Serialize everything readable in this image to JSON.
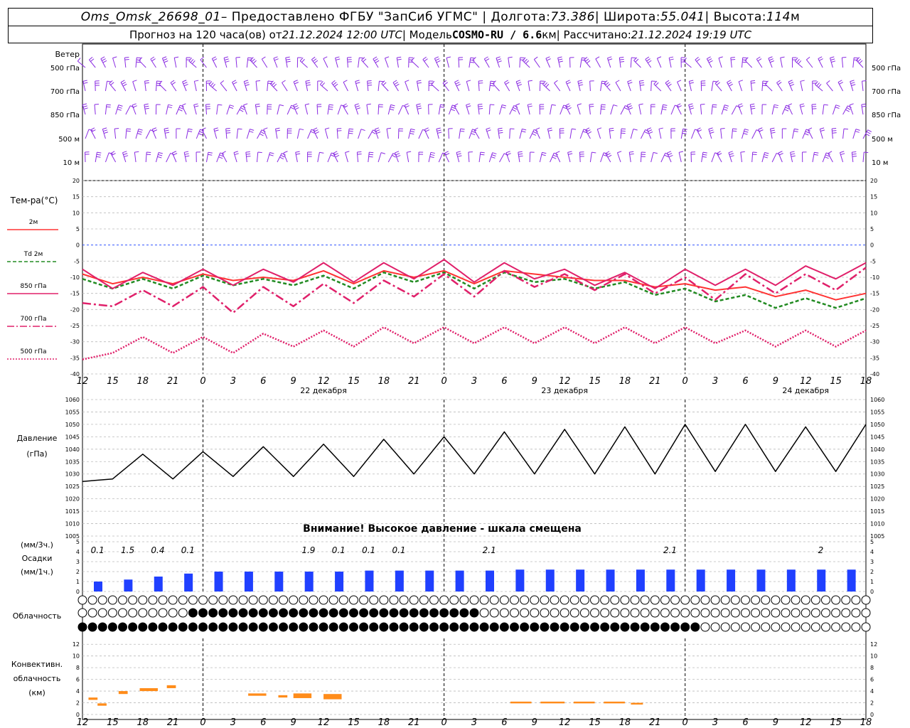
{
  "header": {
    "line1": {
      "station": "Oms_Omsk_26698_01",
      "provider": " – Предоставлено ФГБУ \"ЗапСиб УГМС\" | Долгота: ",
      "lon": "73.386",
      "lat_label": " | Широта: ",
      "lat": "55.041",
      "alt_label": " | Высота: ",
      "alt": "114",
      "alt_unit": "м"
    },
    "line2": {
      "forecast": "Прогноз на 120 часа(ов) от ",
      "run_time": "21.12.2024 12:00 UTC",
      "model_label": " | Модель ",
      "model": "COSMO-RU / 6.6",
      "model_unit": "км",
      "calc_label": " | Рассчитано: ",
      "calc_time": "21.12.2024 19:19 UTC"
    }
  },
  "time_axis": {
    "hour_labels": [
      "12",
      "15",
      "18",
      "21",
      "0",
      "3",
      "6",
      "9",
      "12",
      "15",
      "18",
      "21",
      "0",
      "3",
      "6",
      "9",
      "12",
      "15",
      "18",
      "21",
      "0",
      "3",
      "6",
      "9",
      "12",
      "15",
      "18"
    ],
    "date_labels": [
      "22 декабря",
      "23 декабря",
      "24 декабря"
    ]
  },
  "wind_panel": {
    "title": "Ветер",
    "levels": [
      "500 гПа",
      "700 гПа",
      "850 гПа",
      "500 м",
      "10 м"
    ],
    "colors": {
      "barb": "#8a2be2"
    }
  },
  "temp_panel": {
    "title": "Тем-ра(°С)",
    "legend": [
      {
        "label": "2м",
        "color": "#ff3333",
        "style": "solid"
      },
      {
        "label_sym": "Td",
        "label": "2м",
        "color": "#228b22",
        "style": "dashed"
      },
      {
        "label": "850 гПа",
        "color": "#e0206a",
        "style": "solid"
      },
      {
        "label": "700 гПа",
        "color": "#e0206a",
        "style": "dashdot"
      },
      {
        "label": "500 гПа",
        "color": "#e0206a",
        "style": "dotted"
      }
    ],
    "ticks": [
      "20",
      "15",
      "10",
      "5",
      "0",
      "-5",
      "-10",
      "-15",
      "-20",
      "-25",
      "-30",
      "-35",
      "-40"
    ]
  },
  "pressure_panel": {
    "title1": "Давление",
    "title2": "(гПа)",
    "ticks": [
      "1060",
      "1055",
      "1050",
      "1045",
      "1040",
      "1035",
      "1030",
      "1025",
      "1020",
      "1015",
      "1010",
      "1005"
    ],
    "warning": "Внимание! Высокое давление - шкала смещена"
  },
  "precip_panel": {
    "title1": "(мм/3ч.)",
    "title2": "Осадки",
    "title3": "(мм/1ч.)",
    "ticks": [
      "5",
      "4",
      "3",
      "2",
      "1",
      "0"
    ],
    "totals": [
      {
        "at": 0.5,
        "text": "0.1"
      },
      {
        "at": 1.5,
        "text": "1.5"
      },
      {
        "at": 2.5,
        "text": "0.4"
      },
      {
        "at": 3.5,
        "text": "0.1"
      },
      {
        "at": 7.5,
        "text": "1.9"
      },
      {
        "at": 8.5,
        "text": "0.1"
      },
      {
        "at": 9.5,
        "text": "0.1"
      },
      {
        "at": 10.5,
        "text": "0.1"
      },
      {
        "at": 13.5,
        "text": "2.1"
      },
      {
        "at": 19.5,
        "text": "2.1"
      },
      {
        "at": 24.5,
        "text": "2"
      }
    ]
  },
  "cloud_panel": {
    "title": "Облачность"
  },
  "conv_panel": {
    "title1": "Конвективн.",
    "title2": "облачность",
    "title3": "(км)",
    "ticks": [
      "12",
      "10",
      "8",
      "6",
      "4",
      "2",
      "0"
    ]
  },
  "chart_data": {
    "type": "line",
    "x_hours_from_start": [
      0,
      3,
      6,
      9,
      12,
      15,
      18,
      21,
      24,
      27,
      30,
      33,
      36,
      39,
      42,
      45,
      48,
      51,
      54,
      57,
      60,
      63,
      66,
      69,
      72,
      75,
      78
    ],
    "temperature": {
      "ylim": [
        -40,
        20
      ],
      "series": [
        {
          "name": "2м",
          "values": [
            -10,
            -11,
            -11,
            -11,
            -10,
            -10,
            -11,
            -10,
            -9,
            -11,
            -9,
            -9,
            -9,
            -11,
            -9,
            -8,
            -11,
            -10,
            -12,
            -12,
            -13,
            -13,
            -14,
            -15,
            -15,
            -16,
            -16
          ]
        },
        {
          "name": "Td 2м",
          "values": [
            -12,
            -12,
            -12,
            -12,
            -11,
            -11,
            -12,
            -11,
            -11,
            -12,
            -10,
            -10,
            -10,
            -12,
            -10,
            -10,
            -12,
            -12,
            -13,
            -14,
            -15,
            -16,
            -17,
            -18,
            -18,
            -18,
            -18
          ]
        },
        {
          "name": "850 гПа",
          "values": [
            -10,
            -11,
            -11,
            -10,
            -10,
            -10,
            -10,
            -9,
            -8,
            -9,
            -8,
            -8,
            -7,
            -9,
            -8,
            -8,
            -10,
            -10,
            -11,
            -11,
            -10,
            -10,
            -10,
            -10,
            -9,
            -8,
            -8
          ]
        },
        {
          "name": "700 гПа",
          "values": [
            -21,
            -16,
            -17,
            -16,
            -16,
            -18,
            -16,
            -16,
            -15,
            -15,
            -14,
            -13,
            -12,
            -13,
            -11,
            -10,
            -12,
            -11,
            -12,
            -12,
            -13,
            -14,
            -12,
            -12,
            -12,
            -11,
            -10
          ]
        },
        {
          "name": "500 гПа",
          "values": [
            -38,
            -31,
            -31,
            -31,
            -31,
            -31,
            -30,
            -29,
            -29,
            -29,
            -28,
            -28,
            -28,
            -28,
            -28,
            -28,
            -28,
            -28,
            -28,
            -28,
            -28,
            -28,
            -29,
            -29,
            -29,
            -29,
            -29
          ]
        }
      ]
    },
    "pressure": {
      "ylim": [
        1005,
        1060
      ],
      "values_peak": [
        1027,
        1037,
        1038,
        1038,
        1039,
        1040,
        1041,
        1041,
        1042,
        1043,
        1044,
        1044,
        1045,
        1046,
        1047,
        1048,
        1048,
        1048,
        1049,
        1049,
        1050,
        1050,
        1050,
        1049,
        1049,
        1049,
        1050
      ],
      "values_trough": [
        1027,
        1028,
        1028,
        1028,
        1028,
        1029,
        1029,
        1029,
        1029,
        1029,
        1030,
        1030,
        1030,
        1030,
        1030,
        1030,
        1030,
        1030,
        1030,
        1030,
        1031,
        1031,
        1031,
        1031,
        1031,
        1031,
        1031
      ]
    },
    "precip_3h": {
      "ylim": [
        0,
        5
      ],
      "values": [
        1,
        1.2,
        1.5,
        1.8,
        2,
        2,
        2,
        2,
        2,
        2.1,
        2.1,
        2.1,
        2.1,
        2.1,
        2.2,
        2.2,
        2.2,
        2.2,
        2.2,
        2.2,
        2.2,
        2.2,
        2.2,
        2.2,
        2.2,
        2.2
      ]
    },
    "convective_cloud_km": {
      "ylim": [
        0,
        13
      ],
      "segments": [
        {
          "x0": 0.2,
          "x1": 0.5,
          "bottom": 2.5,
          "top": 2.9
        },
        {
          "x0": 0.5,
          "x1": 0.8,
          "bottom": 1.5,
          "top": 1.9
        },
        {
          "x0": 1.2,
          "x1": 1.5,
          "bottom": 3.5,
          "top": 4.0
        },
        {
          "x0": 1.9,
          "x1": 2.5,
          "bottom": 4.0,
          "top": 4.5
        },
        {
          "x0": 2.8,
          "x1": 3.1,
          "bottom": 4.5,
          "top": 5.0
        },
        {
          "x0": 5.5,
          "x1": 6.1,
          "bottom": 3.2,
          "top": 3.6
        },
        {
          "x0": 6.5,
          "x1": 6.8,
          "bottom": 2.9,
          "top": 3.3
        },
        {
          "x0": 7.0,
          "x1": 7.6,
          "bottom": 2.8,
          "top": 3.6
        },
        {
          "x0": 8.0,
          "x1": 8.6,
          "bottom": 2.6,
          "top": 3.5
        },
        {
          "x0": 14.2,
          "x1": 14.9,
          "bottom": 1.9,
          "top": 2.2
        },
        {
          "x0": 15.2,
          "x1": 16.0,
          "bottom": 1.9,
          "top": 2.2
        },
        {
          "x0": 16.3,
          "x1": 17.0,
          "bottom": 1.9,
          "top": 2.2
        },
        {
          "x0": 17.3,
          "x1": 18.0,
          "bottom": 1.9,
          "top": 2.2
        },
        {
          "x0": 18.2,
          "x1": 18.6,
          "bottom": 1.7,
          "top": 2.0
        }
      ]
    }
  }
}
